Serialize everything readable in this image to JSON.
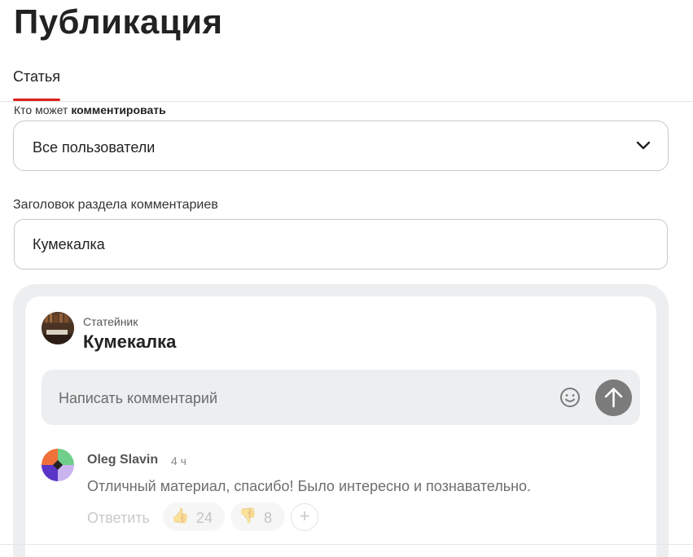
{
  "page": {
    "title": "Публикация"
  },
  "tabs": [
    {
      "label": "Статья",
      "active": true
    }
  ],
  "who_can_comment": {
    "label_prefix": "Кто может ",
    "label_bold": "комментировать",
    "selected": "Все пользователи"
  },
  "comments_heading": {
    "label": "Заголовок раздела комментариев",
    "value": "Кумекалка"
  },
  "preview": {
    "source_name": "Статейник",
    "title": "Кумекалка",
    "input_placeholder": "Написать комментарий",
    "comment": {
      "author": "Oleg Slavin",
      "time": "4 ч",
      "text": "Отличный материал, спасибо! Было интересно и познавательно.",
      "reply_label": "Ответить",
      "likes": "24",
      "dislikes": "8"
    }
  },
  "icons": {
    "dropdown": "chevron-down-icon",
    "emoji": "smiley-icon",
    "send": "arrow-up-icon",
    "like": "thumbs-up-icon",
    "dislike": "thumbs-down-icon",
    "add_reaction": "plus-icon"
  },
  "colors": {
    "accent": "#e0201e",
    "send_button": "#7b7b7b",
    "preview_bg": "#eceef0"
  }
}
